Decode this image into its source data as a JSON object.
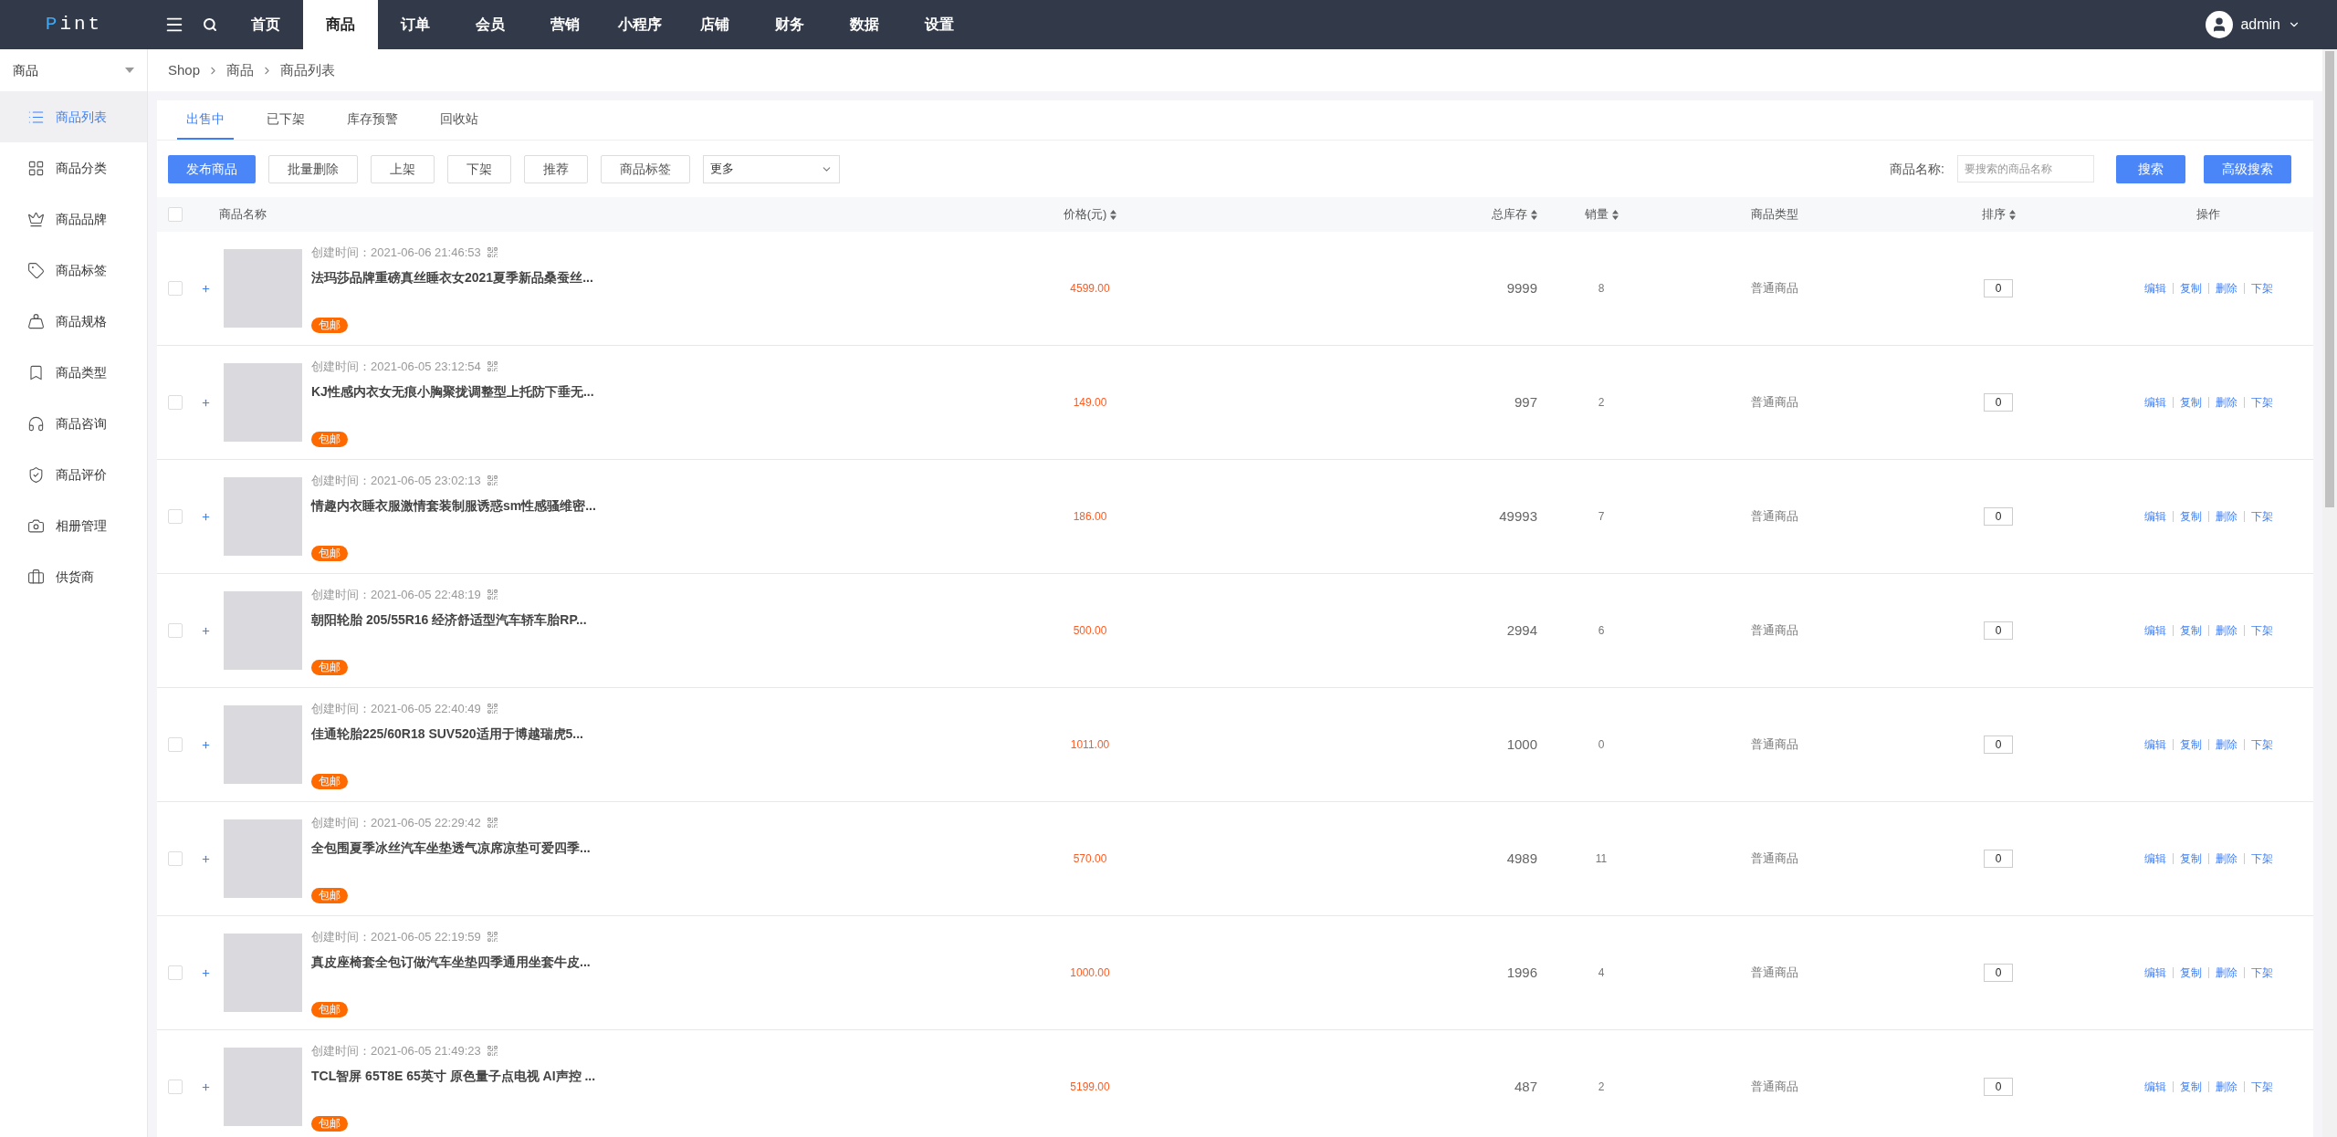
{
  "topbar": {
    "logo": "Pint",
    "nav": [
      {
        "label": "首页",
        "selected": false
      },
      {
        "label": "商品",
        "selected": true
      },
      {
        "label": "订单",
        "selected": false
      },
      {
        "label": "会员",
        "selected": false
      },
      {
        "label": "营销",
        "selected": false
      },
      {
        "label": "小程序",
        "selected": false
      },
      {
        "label": "店铺",
        "selected": false
      },
      {
        "label": "财务",
        "selected": false
      },
      {
        "label": "数据",
        "selected": false
      },
      {
        "label": "设置",
        "selected": false
      }
    ],
    "user": "admin"
  },
  "sidebar": {
    "title": "商品",
    "items": [
      {
        "label": "商品列表",
        "selected": true
      },
      {
        "label": "商品分类",
        "selected": false
      },
      {
        "label": "商品品牌",
        "selected": false
      },
      {
        "label": "商品标签",
        "selected": false
      },
      {
        "label": "商品规格",
        "selected": false
      },
      {
        "label": "商品类型",
        "selected": false
      },
      {
        "label": "商品咨询",
        "selected": false
      },
      {
        "label": "商品评价",
        "selected": false
      },
      {
        "label": "相册管理",
        "selected": false
      },
      {
        "label": "供货商",
        "selected": false
      }
    ]
  },
  "breadcrumb": [
    "Shop",
    "商品",
    "商品列表"
  ],
  "tabs": [
    {
      "label": "出售中",
      "selected": true
    },
    {
      "label": "已下架",
      "selected": false
    },
    {
      "label": "库存预警",
      "selected": false
    },
    {
      "label": "回收站",
      "selected": false
    }
  ],
  "toolbar": {
    "buttons": [
      {
        "label": "发布商品",
        "kind": "primary"
      },
      {
        "label": "批量删除",
        "kind": "plain"
      },
      {
        "label": "上架",
        "kind": "plain"
      },
      {
        "label": "下架",
        "kind": "plain"
      },
      {
        "label": "推荐",
        "kind": "plain"
      },
      {
        "label": "商品标签",
        "kind": "plain"
      }
    ],
    "more_select": "更多",
    "search_label": "商品名称:",
    "search_placeholder": "要搜索的商品名称",
    "search_button": "搜索",
    "advanced_button": "高级搜索"
  },
  "table": {
    "select_all_checked": false,
    "columns": [
      {
        "label": "商品名称",
        "sortable": false
      },
      {
        "label": "价格(元)",
        "sortable": true
      },
      {
        "label": "总库存",
        "sortable": true
      },
      {
        "label": "销量",
        "sortable": true
      },
      {
        "label": "商品类型",
        "sortable": false
      },
      {
        "label": "排序",
        "sortable": true
      },
      {
        "label": "操作",
        "sortable": false
      }
    ],
    "rows": [
      {
        "checked": false,
        "created_label": "创建时间：",
        "created": "2021-06-06 21:46:53",
        "title": "法玛莎品牌重磅真丝睡衣女2021夏季新品桑蚕丝...",
        "tag": "包邮",
        "price": "4599.00",
        "stock": "9999",
        "sales": "8",
        "type": "普通商品",
        "sort": "0",
        "actions": [
          "编辑",
          "复制",
          "删除",
          "下架"
        ]
      },
      {
        "checked": false,
        "created_label": "创建时间：",
        "created": "2021-06-05 23:12:54",
        "title": "KJ性感内衣女无痕小胸聚拢调整型上托防下垂无...",
        "tag": "包邮",
        "price": "149.00",
        "stock": "997",
        "sales": "2",
        "type": "普通商品",
        "sort": "0",
        "actions": [
          "编辑",
          "复制",
          "删除",
          "下架"
        ]
      },
      {
        "checked": false,
        "created_label": "创建时间：",
        "created": "2021-06-05 23:02:13",
        "title": "情趣内衣睡衣服激情套装制服诱惑sm性感骚维密...",
        "tag": "包邮",
        "price": "186.00",
        "stock": "49993",
        "sales": "7",
        "type": "普通商品",
        "sort": "0",
        "actions": [
          "编辑",
          "复制",
          "删除",
          "下架"
        ]
      },
      {
        "checked": false,
        "created_label": "创建时间：",
        "created": "2021-06-05 22:48:19",
        "title": "朝阳轮胎 205/55R16 经济舒适型汽车轿车胎RP...",
        "tag": "包邮",
        "price": "500.00",
        "stock": "2994",
        "sales": "6",
        "type": "普通商品",
        "sort": "0",
        "actions": [
          "编辑",
          "复制",
          "删除",
          "下架"
        ]
      },
      {
        "checked": false,
        "created_label": "创建时间：",
        "created": "2021-06-05 22:40:49",
        "title": "佳通轮胎225/60R18 SUV520适用于博越瑞虎5...",
        "tag": "包邮",
        "price": "1011.00",
        "stock": "1000",
        "sales": "0",
        "type": "普通商品",
        "sort": "0",
        "actions": [
          "编辑",
          "复制",
          "删除",
          "下架"
        ]
      },
      {
        "checked": false,
        "created_label": "创建时间：",
        "created": "2021-06-05 22:29:42",
        "title": "全包围夏季冰丝汽车坐垫透气凉席凉垫可爱四季...",
        "tag": "包邮",
        "price": "570.00",
        "stock": "4989",
        "sales": "11",
        "type": "普通商品",
        "sort": "0",
        "actions": [
          "编辑",
          "复制",
          "删除",
          "下架"
        ]
      },
      {
        "checked": false,
        "created_label": "创建时间：",
        "created": "2021-06-05 22:19:59",
        "title": "真皮座椅套全包订做汽车坐垫四季通用坐套牛皮...",
        "tag": "包邮",
        "price": "1000.00",
        "stock": "1996",
        "sales": "4",
        "type": "普通商品",
        "sort": "0",
        "actions": [
          "编辑",
          "复制",
          "删除",
          "下架"
        ]
      },
      {
        "checked": false,
        "created_label": "创建时间：",
        "created": "2021-06-05 21:49:23",
        "title": "TCL智屏 65T8E 65英寸 原色量子点电视 AI声控 ...",
        "tag": "包邮",
        "price": "5199.00",
        "stock": "487",
        "sales": "2",
        "type": "普通商品",
        "sort": "0",
        "actions": [
          "编辑",
          "复制",
          "删除",
          "下架"
        ]
      }
    ]
  }
}
